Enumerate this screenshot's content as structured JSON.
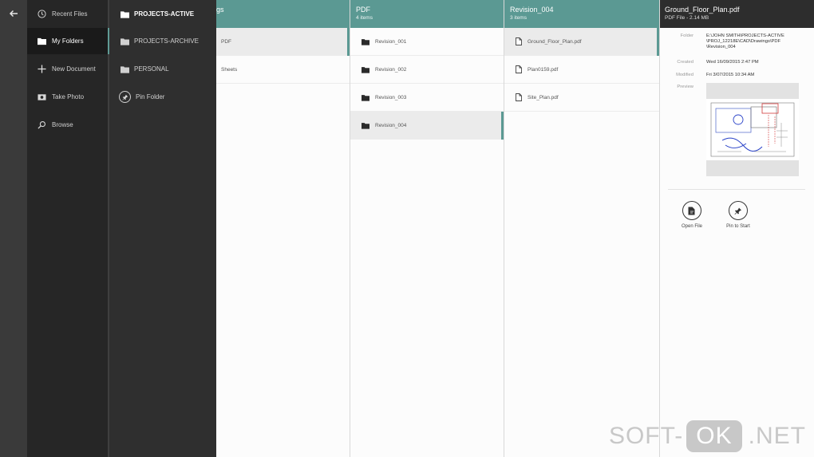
{
  "nav": {
    "items": [
      {
        "label": "Recent Files",
        "icon": "clock-icon"
      },
      {
        "label": "My Folders",
        "icon": "folder-icon"
      },
      {
        "label": "New Document",
        "icon": "plus-icon"
      },
      {
        "label": "Take Photo",
        "icon": "camera-icon"
      },
      {
        "label": "Browse",
        "icon": "search-icon"
      }
    ]
  },
  "folders": {
    "items": [
      {
        "label": "PROJECTS-ACTIVE"
      },
      {
        "label": "PROJECTS-ARCHIVE"
      },
      {
        "label": "PERSONAL"
      },
      {
        "label": "Pin Folder"
      }
    ]
  },
  "col1": {
    "title": "gs",
    "rows": [
      "PDF",
      "Sheets"
    ]
  },
  "col2": {
    "title": "PDF",
    "subtitle": "4 items",
    "rows": [
      "Revision_001",
      "Revision_002",
      "Revision_003",
      "Revision_004"
    ]
  },
  "col3": {
    "title": "Revision_004",
    "subtitle": "3 items",
    "rows": [
      "Ground_Floor_Plan.pdf",
      "Plan0159.pdf",
      "Site_Plan.pdf"
    ]
  },
  "details": {
    "title": "Ground_Floor_Plan.pdf",
    "subtitle": "PDF File  -  2.14 MB",
    "folder_label": "Folder",
    "folder_value": "E:\\JOHN SMITH\\PROJECTS-ACTIVE\n\\PROJ_12218E\\CAD\\Drawings\\PDF\n\\Revision_004",
    "created_label": "Created",
    "created_value": "Wed 16/09/2015 2:47 PM",
    "modified_label": "Modified",
    "modified_value": "Fri 3/07/2015 10:34 AM",
    "preview_label": "Preview",
    "open_label": "Open File",
    "pin_label": "Pin to Start"
  },
  "watermark": {
    "left": "SOFT-",
    "mid": "OK",
    "right": ".NET"
  },
  "colors": {
    "accent": "#5b9993",
    "nav_bg": "#262626",
    "folders_bg": "#2f2f2f"
  }
}
